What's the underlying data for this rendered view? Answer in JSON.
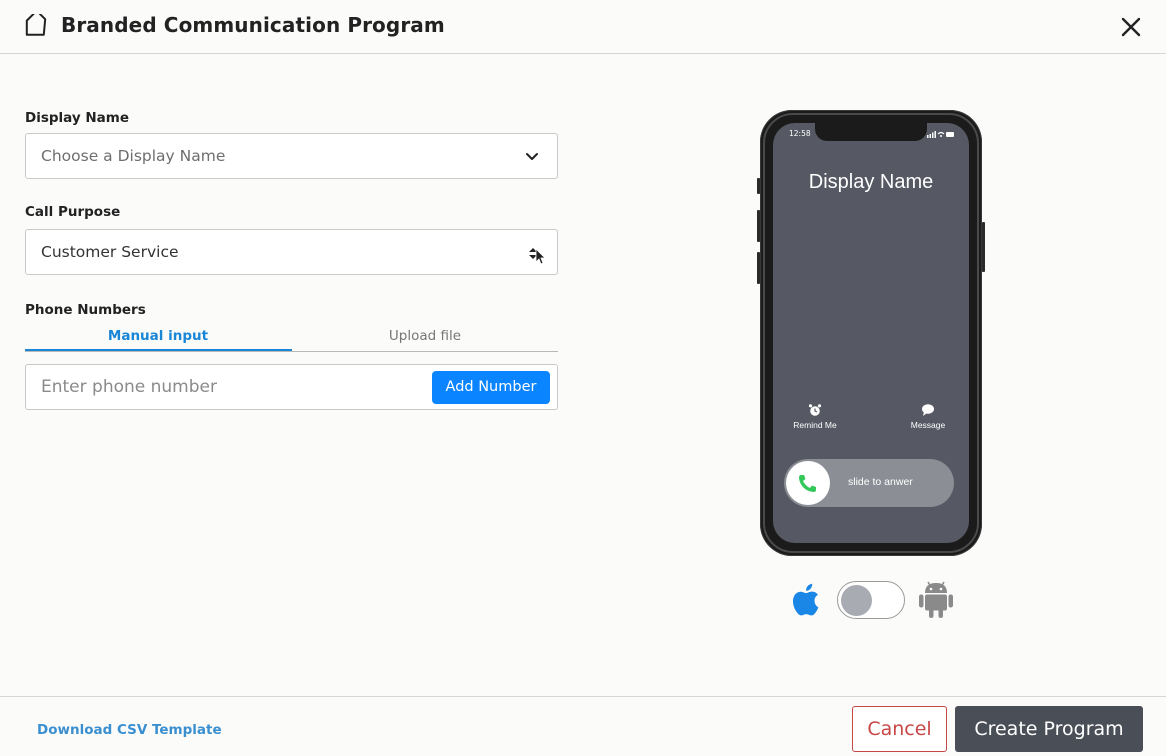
{
  "header": {
    "title": "Branded Communication Program",
    "icon": "tag-icon",
    "close_icon": "close-icon"
  },
  "form": {
    "display_name": {
      "label": "Display Name",
      "placeholder": "Choose a Display Name",
      "icon": "chevron-down-icon"
    },
    "call_purpose": {
      "label": "Call Purpose",
      "value": "Customer Service",
      "icon": "sort-updown-icon"
    },
    "phone_numbers": {
      "label": "Phone Numbers",
      "tabs": [
        {
          "label": "Manual input",
          "active": true
        },
        {
          "label": "Upload file",
          "active": false
        }
      ],
      "input_placeholder": "Enter phone number",
      "add_button": "Add Number"
    }
  },
  "preview": {
    "status_time": "12:58",
    "caller_name": "Display Name",
    "actions": [
      {
        "label": "Remind Me",
        "icon": "alarm-icon"
      },
      {
        "label": "Message",
        "icon": "message-icon"
      }
    ],
    "slider_text": "slide to anwer",
    "os_toggle": {
      "left_icon": "apple-icon",
      "right_icon": "android-icon",
      "selected": "iOS"
    }
  },
  "footer": {
    "download_link": "Download CSV Template",
    "cancel_button": "Cancel",
    "create_button": "Create Program"
  },
  "colors": {
    "accent": "#0b85ff",
    "tab_active": "#1a86d6",
    "cancel": "#c74747",
    "primary_button": "#4a4e57",
    "phone_screen": "#565963"
  }
}
